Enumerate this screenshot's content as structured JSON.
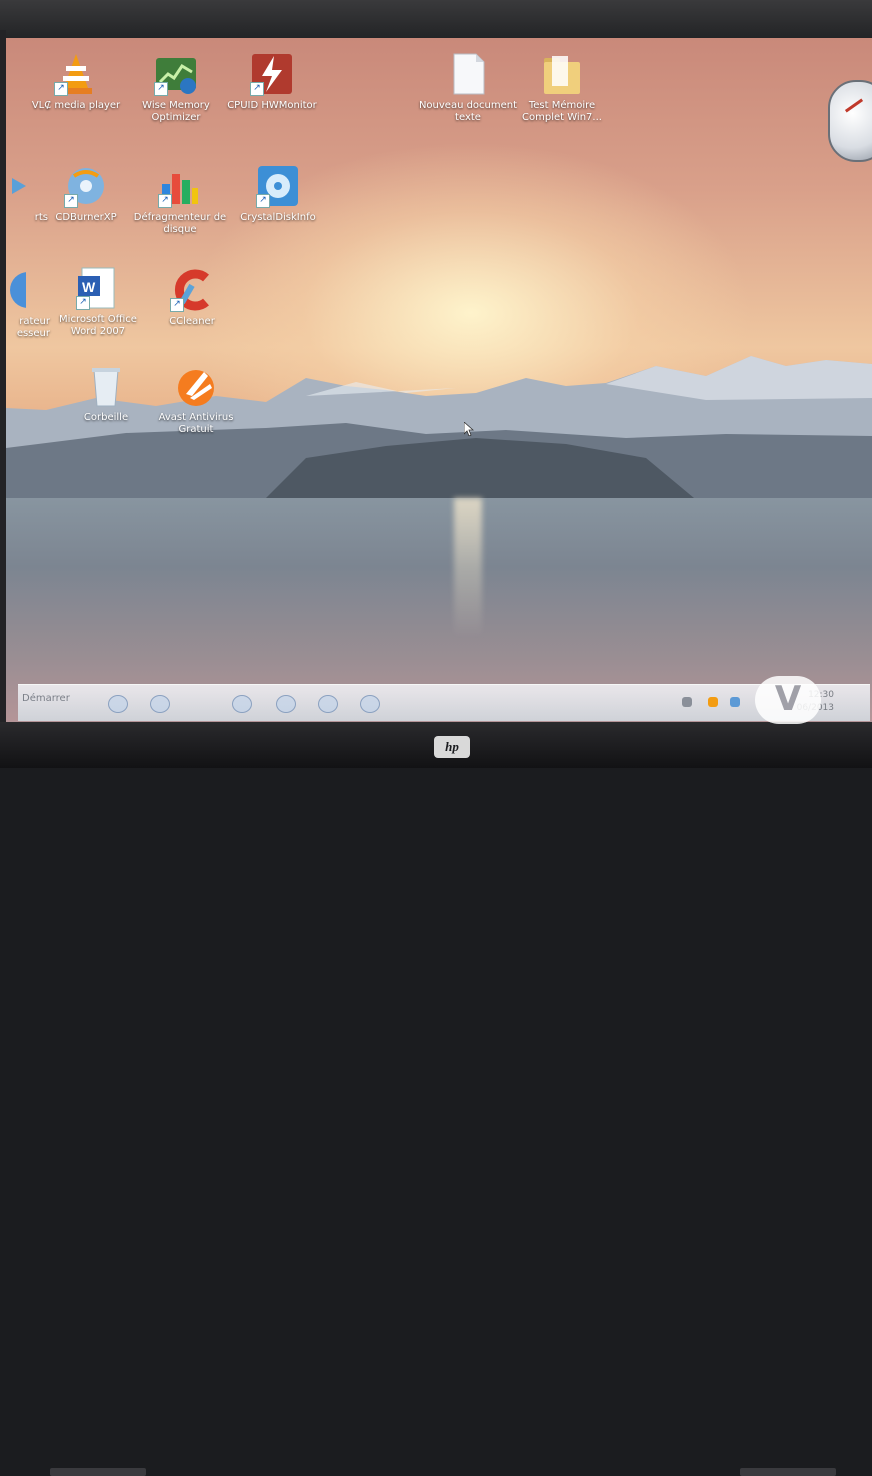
{
  "desktop": {
    "icons": [
      {
        "id": "vlc",
        "label": "VLC media player",
        "icon": "vlc-cone-icon"
      },
      {
        "id": "wise-memory",
        "label": "Wise Memory Optimizer",
        "icon": "memory-chart-icon"
      },
      {
        "id": "cpuid",
        "label": "CPUID HWMonitor",
        "icon": "hwmonitor-icon"
      },
      {
        "id": "nouveau-doc",
        "label": "Nouveau document texte",
        "icon": "text-document-icon"
      },
      {
        "id": "test-memoire",
        "label": "Test Mémoire Complet Win7...",
        "icon": "folder-icon"
      },
      {
        "id": "cdburner",
        "label": "CDBurnerXP",
        "icon": "cd-burn-icon"
      },
      {
        "id": "defrag",
        "label": "Défragmenteur de disque",
        "icon": "defrag-icon"
      },
      {
        "id": "crystaldisk",
        "label": "CrystalDiskInfo",
        "icon": "disk-info-icon"
      },
      {
        "id": "word",
        "label": "Microsoft Office Word 2007",
        "icon": "word-document-icon"
      },
      {
        "id": "ccleaner",
        "label": "CCleaner",
        "icon": "ccleaner-icon"
      },
      {
        "id": "corbeille",
        "label": "Corbeille",
        "icon": "recycle-bin-icon"
      },
      {
        "id": "avast",
        "label": "Avast Antivirus Gratuit",
        "icon": "avast-icon"
      }
    ],
    "partial_labels": [
      "rts",
      "rateur",
      "esseur"
    ]
  },
  "taskbar": {
    "start_label": "Démarrer",
    "clock_time": "12:30",
    "clock_date": "06/2013"
  },
  "laptop": {
    "brand": "hp"
  },
  "watermark": "V",
  "colors": {
    "sky_top": "#c9897a",
    "sun_glow": "#fff6ce",
    "taskbar": "#e9e6ea"
  }
}
